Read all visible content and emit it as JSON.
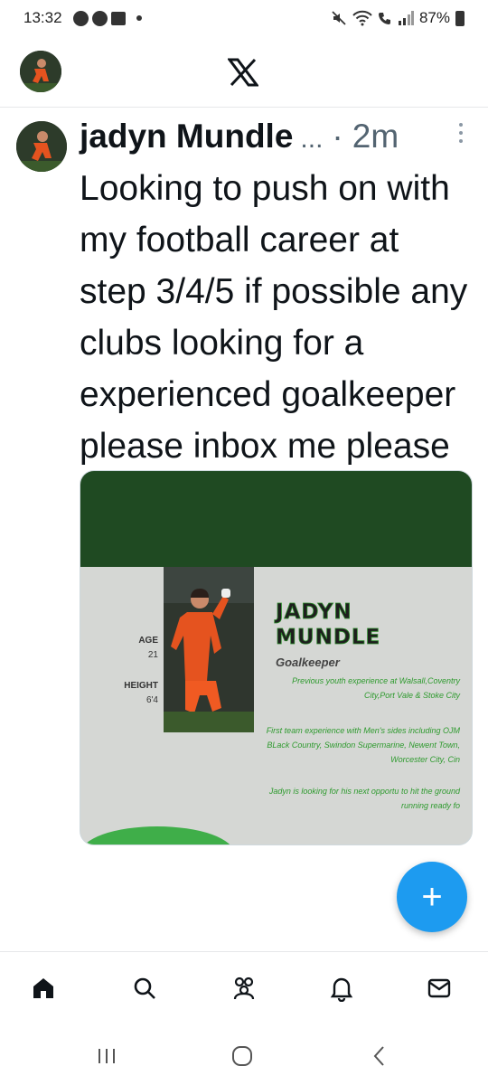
{
  "status_bar": {
    "time": "13:32",
    "battery": "87%"
  },
  "header": {
    "logo_icon": "x-logo-icon"
  },
  "tweet": {
    "author": "jadyn Mundle",
    "ellipsis": "...",
    "separator": "·",
    "time_ago": "2m",
    "text": "Looking to push on with my football career at step 3/4/5 if possible any clubs looking for a experienced goalkeeper please inbox me please",
    "media": {
      "name_line1": "JADYN",
      "name_line2": "MUNDLE",
      "role": "Goalkeeper",
      "age_label": "AGE",
      "age_value": "21",
      "height_label": "HEIGHT",
      "height_value": "6'4",
      "youth_text": "Previous youth experience at Walsall,Coventry City,Port Vale & Stoke City",
      "first_team_text": "First team experience with Men's sides including OJM BLack Country, Swindon Supermarine, Newent Town, Worcester City, Cin",
      "looking_text": "Jadyn is looking for his next opportu to hit the ground running ready fo"
    }
  },
  "fab": {
    "icon": "plus-icon",
    "symbol": "+"
  },
  "bottom_nav": [
    "home-icon",
    "search-icon",
    "communities-icon",
    "notifications-icon",
    "messages-icon"
  ],
  "colors": {
    "accent": "#1d9bf0",
    "banner_green": "#1f4a22",
    "text_green": "#2e9a2e"
  }
}
